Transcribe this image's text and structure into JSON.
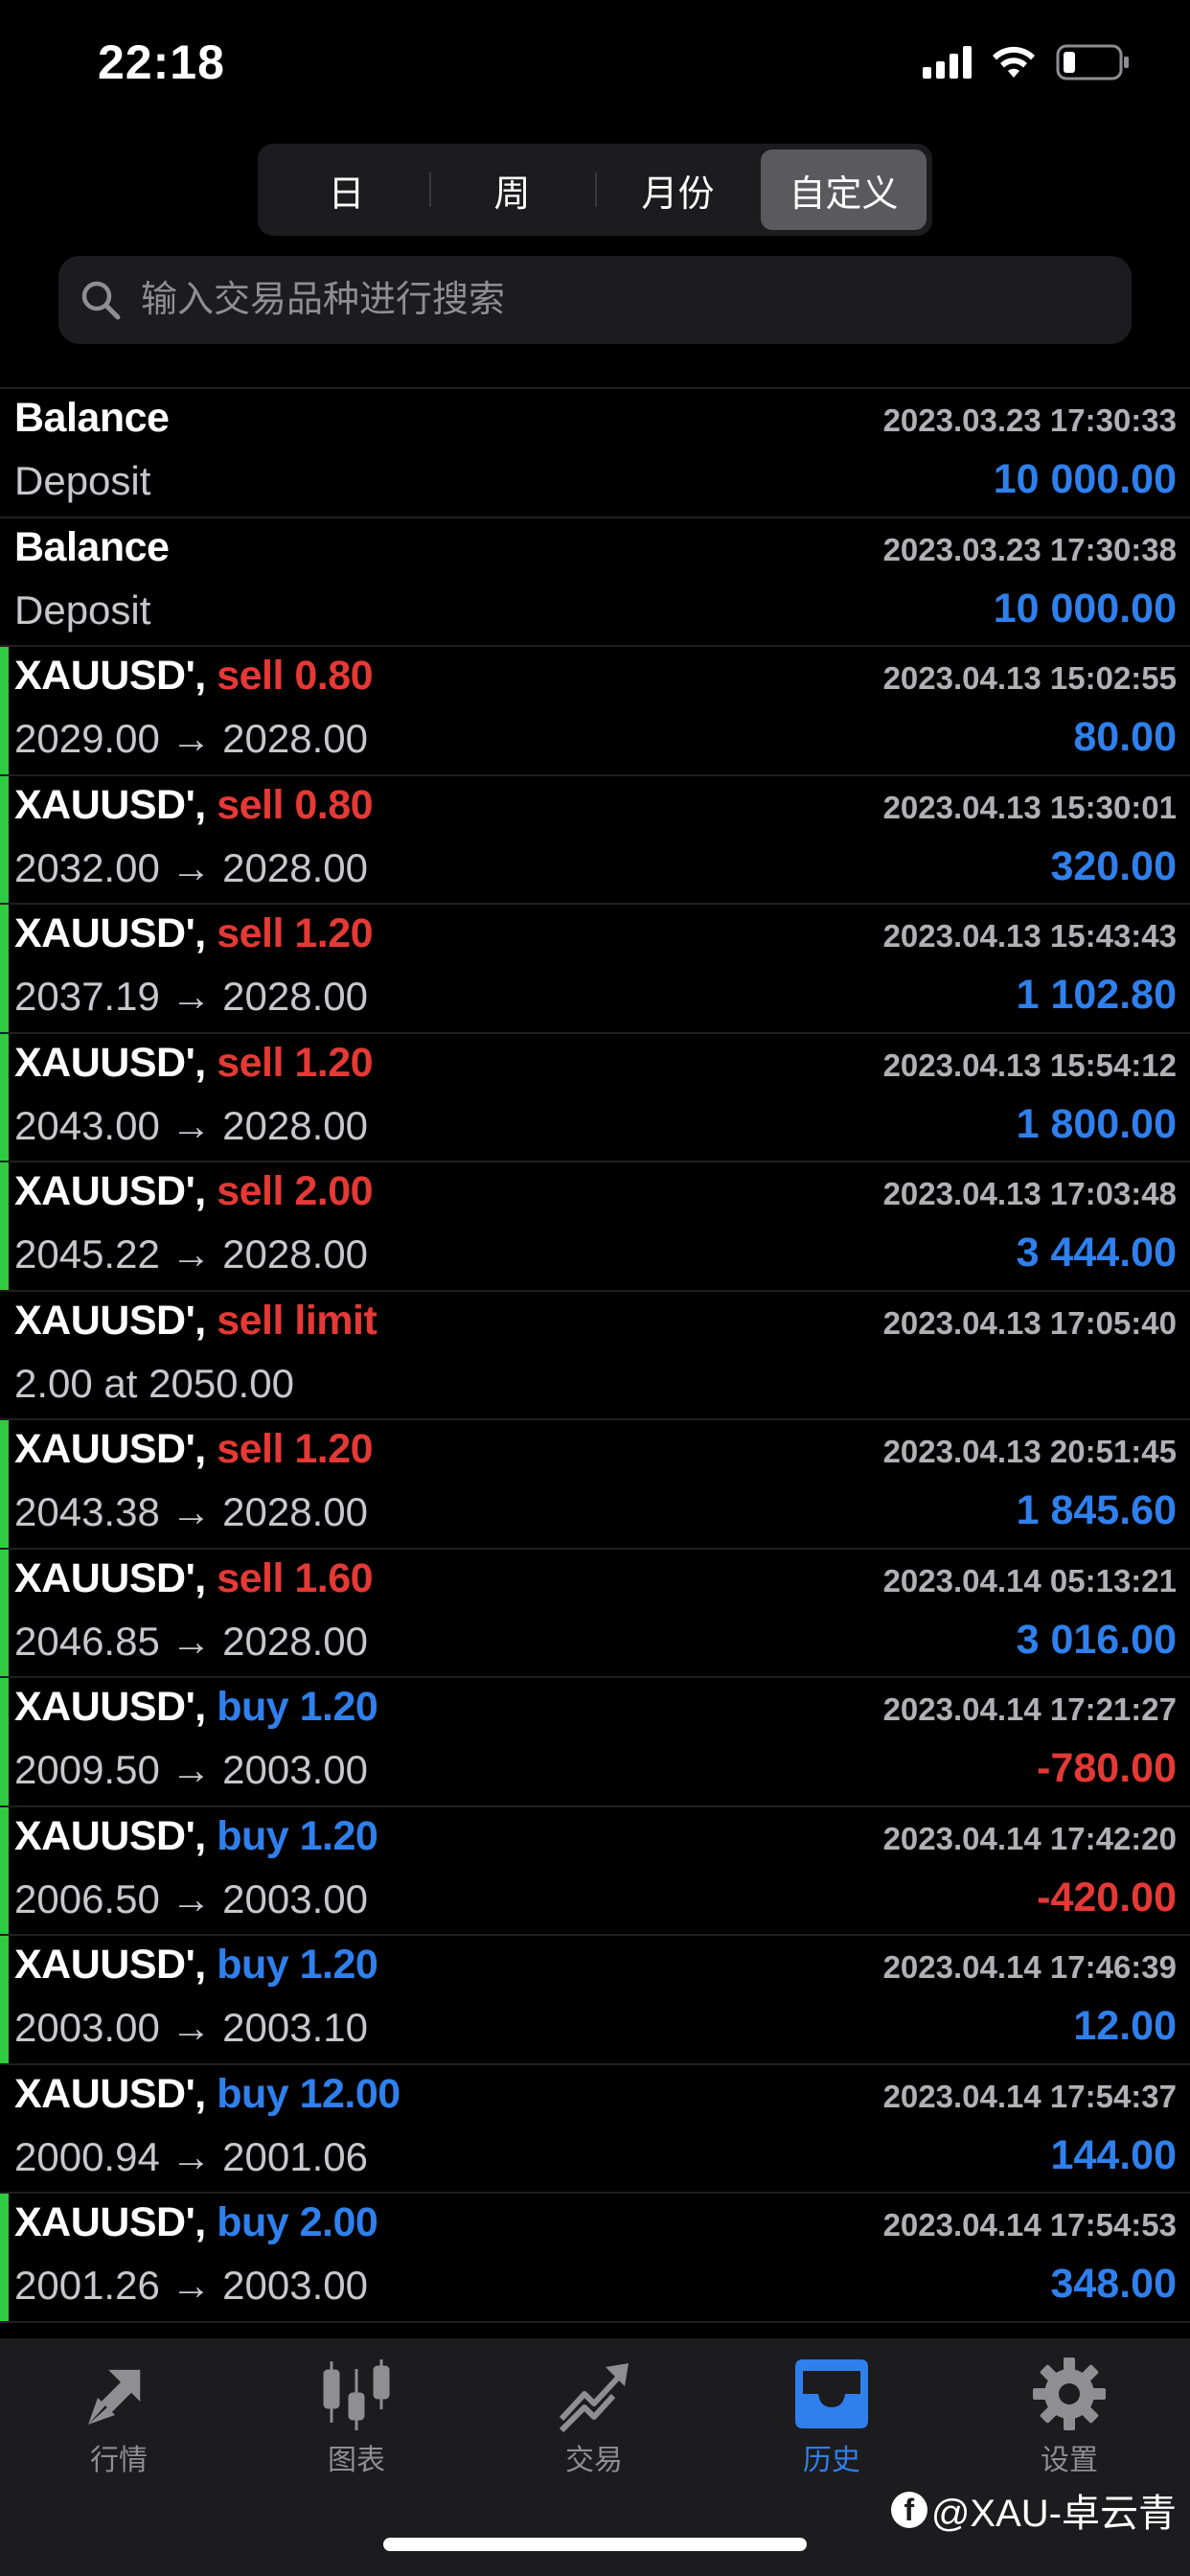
{
  "status_bar": {
    "time": "22:18"
  },
  "period_tabs": [
    {
      "label": "日",
      "active": false
    },
    {
      "label": "周",
      "active": false
    },
    {
      "label": "月份",
      "active": false
    },
    {
      "label": "自定义",
      "active": true
    }
  ],
  "search": {
    "placeholder": "输入交易品种进行搜索"
  },
  "rows": [
    {
      "title": "Balance",
      "side": "",
      "side_type": "",
      "sub": "Deposit",
      "time": "2023.03.23 17:30:33",
      "amount": "10 000.00",
      "amount_type": "pos",
      "marked": false
    },
    {
      "title": "Balance",
      "side": "",
      "side_type": "",
      "sub": "Deposit",
      "time": "2023.03.23 17:30:38",
      "amount": "10 000.00",
      "amount_type": "pos",
      "marked": false
    },
    {
      "title": "XAUUSD',",
      "side": "sell 0.80",
      "side_type": "sell",
      "sub": "2029.00 → 2028.00",
      "time": "2023.04.13 15:02:55",
      "amount": "80.00",
      "amount_type": "pos",
      "marked": true
    },
    {
      "title": "XAUUSD',",
      "side": "sell 0.80",
      "side_type": "sell",
      "sub": "2032.00 → 2028.00",
      "time": "2023.04.13 15:30:01",
      "amount": "320.00",
      "amount_type": "pos",
      "marked": true
    },
    {
      "title": "XAUUSD',",
      "side": "sell 1.20",
      "side_type": "sell",
      "sub": "2037.19 → 2028.00",
      "time": "2023.04.13 15:43:43",
      "amount": "1 102.80",
      "amount_type": "pos",
      "marked": true
    },
    {
      "title": "XAUUSD',",
      "side": "sell 1.20",
      "side_type": "sell",
      "sub": "2043.00 → 2028.00",
      "time": "2023.04.13 15:54:12",
      "amount": "1 800.00",
      "amount_type": "pos",
      "marked": true
    },
    {
      "title": "XAUUSD',",
      "side": "sell 2.00",
      "side_type": "sell",
      "sub": "2045.22 → 2028.00",
      "time": "2023.04.13 17:03:48",
      "amount": "3 444.00",
      "amount_type": "pos",
      "marked": true
    },
    {
      "title": "XAUUSD',",
      "side": "sell limit",
      "side_type": "sell",
      "sub": "2.00 at 2050.00",
      "time": "2023.04.13 17:05:40",
      "amount": "",
      "amount_type": "pos",
      "marked": false
    },
    {
      "title": "XAUUSD',",
      "side": "sell 1.20",
      "side_type": "sell",
      "sub": "2043.38 → 2028.00",
      "time": "2023.04.13 20:51:45",
      "amount": "1 845.60",
      "amount_type": "pos",
      "marked": true
    },
    {
      "title": "XAUUSD',",
      "side": "sell 1.60",
      "side_type": "sell",
      "sub": "2046.85 → 2028.00",
      "time": "2023.04.14 05:13:21",
      "amount": "3 016.00",
      "amount_type": "pos",
      "marked": true
    },
    {
      "title": "XAUUSD',",
      "side": "buy 1.20",
      "side_type": "buy",
      "sub": "2009.50 → 2003.00",
      "time": "2023.04.14 17:21:27",
      "amount": "-780.00",
      "amount_type": "neg",
      "marked": true
    },
    {
      "title": "XAUUSD',",
      "side": "buy 1.20",
      "side_type": "buy",
      "sub": "2006.50 → 2003.00",
      "time": "2023.04.14 17:42:20",
      "amount": "-420.00",
      "amount_type": "neg",
      "marked": true
    },
    {
      "title": "XAUUSD',",
      "side": "buy 1.20",
      "side_type": "buy",
      "sub": "2003.00 → 2003.10",
      "time": "2023.04.14 17:46:39",
      "amount": "12.00",
      "amount_type": "pos",
      "marked": true
    },
    {
      "title": "XAUUSD',",
      "side": "buy 12.00",
      "side_type": "buy",
      "sub": "2000.94 → 2001.06",
      "time": "2023.04.14 17:54:37",
      "amount": "144.00",
      "amount_type": "pos",
      "marked": false
    },
    {
      "title": "XAUUSD',",
      "side": "buy 2.00",
      "side_type": "buy",
      "sub": "2001.26 → 2003.00",
      "time": "2023.04.14 17:54:53",
      "amount": "348.00",
      "amount_type": "pos",
      "marked": true
    }
  ],
  "tabbar": [
    {
      "label": "行情",
      "icon": "quotes-arrows-icon",
      "active": false
    },
    {
      "label": "图表",
      "icon": "candlestick-chart-icon",
      "active": false
    },
    {
      "label": "交易",
      "icon": "trade-trend-icon",
      "active": false
    },
    {
      "label": "历史",
      "icon": "history-inbox-icon",
      "active": true
    },
    {
      "label": "设置",
      "icon": "gear-icon",
      "active": false
    }
  ],
  "watermark": {
    "text": "@XAU-卓云青",
    "logo": "f"
  },
  "colors": {
    "sell": "#e53935",
    "buy": "#2f80ed",
    "positive": "#2f80ed",
    "negative": "#e53935",
    "marker": "#2ecc40",
    "active_tab": "#2f80ed"
  }
}
